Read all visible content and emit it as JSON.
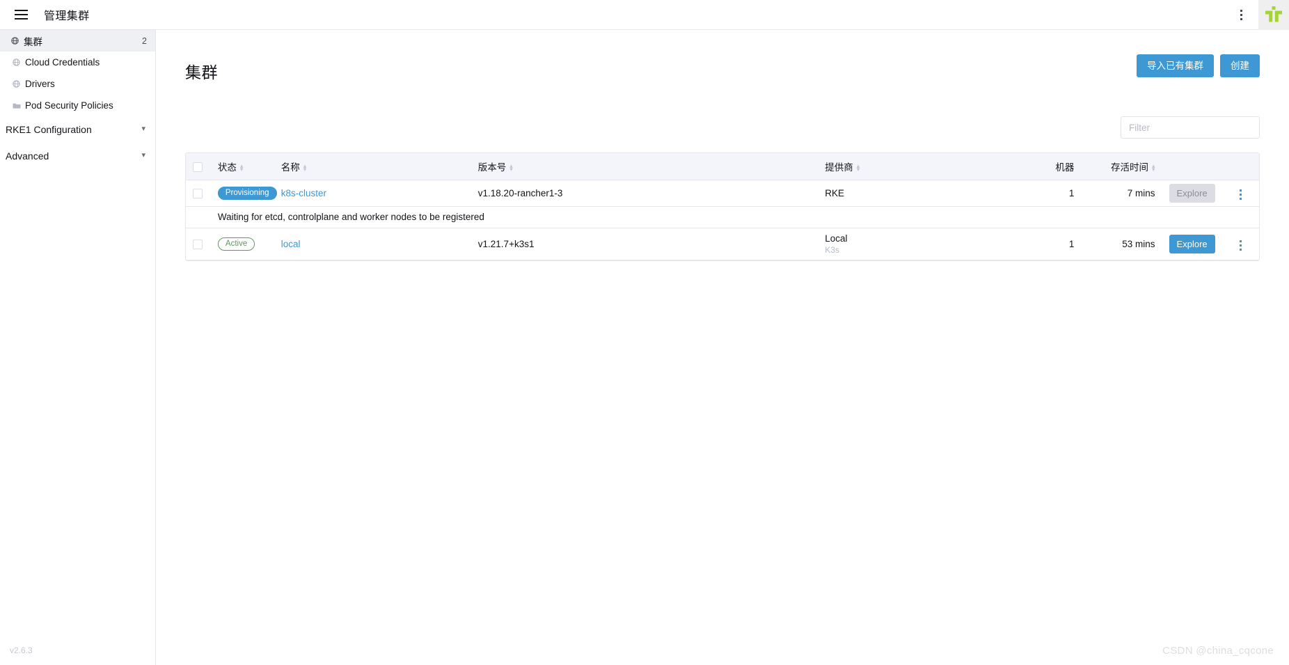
{
  "topbar": {
    "menu_icon": "hamburger-icon",
    "title": "管理集群",
    "kebab_icon": "vertical-dots-icon",
    "logo_alt": "rancher-logo"
  },
  "sidebar": {
    "items": [
      {
        "label": "集群",
        "icon": "globe-icon",
        "count": "2",
        "active": true
      },
      {
        "label": "Cloud Credentials",
        "icon": "globe-icon",
        "count": "",
        "active": false
      },
      {
        "label": "Drivers",
        "icon": "globe-icon",
        "count": "",
        "active": false
      },
      {
        "label": "Pod Security Policies",
        "icon": "folder-icon",
        "count": "",
        "active": false
      }
    ],
    "groups": [
      {
        "label": "RKE1 Configuration",
        "chevron": "chevron-down-icon"
      },
      {
        "label": "Advanced",
        "chevron": "chevron-down-icon"
      }
    ],
    "version": "v2.6.3"
  },
  "page": {
    "title": "集群",
    "import_button": "导入已有集群",
    "create_button": "创建"
  },
  "filter": {
    "placeholder": "Filter",
    "value": ""
  },
  "table": {
    "columns": [
      {
        "label": "状态",
        "sortable": true
      },
      {
        "label": "名称",
        "sortable": true
      },
      {
        "label": "版本号",
        "sortable": true
      },
      {
        "label": "提供商",
        "sortable": true
      },
      {
        "label": "机器",
        "sortable": false
      },
      {
        "label": "存活时间",
        "sortable": true
      }
    ],
    "rows": [
      {
        "state": "Provisioning",
        "state_style": "provisioning",
        "name": "k8s-cluster",
        "version": "v1.18.20-rancher1-3",
        "provider": "RKE",
        "provider_sub": "",
        "machines": "1",
        "age": "7 mins",
        "explore_label": "Explore",
        "explore_enabled": false,
        "message": "Waiting for etcd, controlplane and worker nodes to be registered"
      },
      {
        "state": "Active",
        "state_style": "active",
        "name": "local",
        "version": "v1.21.7+k3s1",
        "provider": "Local",
        "provider_sub": "K3s",
        "machines": "1",
        "age": "53 mins",
        "explore_label": "Explore",
        "explore_enabled": true,
        "message": ""
      }
    ]
  },
  "watermark": "CSDN @china_cqcone",
  "colors": {
    "accent": "#3d98d3",
    "brand_green": "#a5d533",
    "active_green": "#5d995d",
    "header_bg": "#f4f5fa",
    "border": "#e4e6eb"
  }
}
